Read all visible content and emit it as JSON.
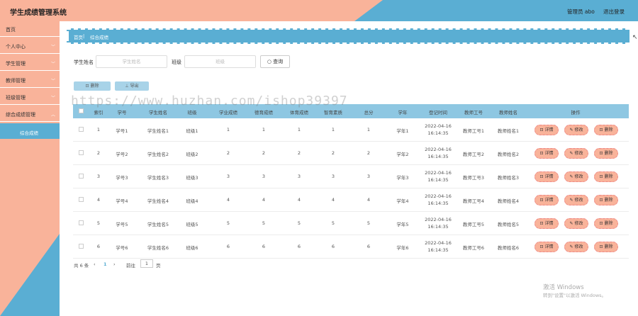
{
  "header": {
    "title": "学生成绩管理系统",
    "user": "管理员 abo",
    "logout": "退出登录"
  },
  "sidebar": {
    "items": [
      {
        "label": "首页",
        "chevron": ""
      },
      {
        "label": "个人中心",
        "chevron": "﹀"
      },
      {
        "label": "学生管理",
        "chevron": "﹀"
      },
      {
        "label": "教师管理",
        "chevron": "﹀"
      },
      {
        "label": "班级管理",
        "chevron": "﹀"
      },
      {
        "label": "综合成绩管理",
        "chevron": "︿"
      }
    ],
    "sub_item": "综合成绩"
  },
  "breadcrumb": {
    "home": "首页",
    "separator": "|",
    "current": "综合成绩"
  },
  "search": {
    "name_label": "学生姓名",
    "name_placeholder": "学生姓名",
    "class_label": "班级",
    "class_placeholder": "班级",
    "button": "查询"
  },
  "toolbar": {
    "delete": "删除",
    "export": "导出"
  },
  "watermark": "https://www.huzhan.com/ishop39397",
  "table": {
    "headers": [
      "索引",
      "学号",
      "学生姓名",
      "班级",
      "学业成绩",
      "德育成绩",
      "体育成绩",
      "智育素质",
      "总分",
      "学年",
      "登记时间",
      "教师工号",
      "教师姓名",
      "操作"
    ],
    "rows": [
      [
        "1",
        "学号1",
        "学生姓名1",
        "班级1",
        "1",
        "1",
        "1",
        "1",
        "1",
        "学年1",
        "2022-04-16",
        "16:14:35",
        "教师工号1",
        "教师姓名1"
      ],
      [
        "2",
        "学号2",
        "学生姓名2",
        "班级2",
        "2",
        "2",
        "2",
        "2",
        "2",
        "学年2",
        "2022-04-16",
        "16:14:35",
        "教师工号2",
        "教师姓名2"
      ],
      [
        "3",
        "学号3",
        "学生姓名3",
        "班级3",
        "3",
        "3",
        "3",
        "3",
        "3",
        "学年3",
        "2022-04-16",
        "16:14:35",
        "教师工号3",
        "教师姓名3"
      ],
      [
        "4",
        "学号4",
        "学生姓名4",
        "班级4",
        "4",
        "4",
        "4",
        "4",
        "4",
        "学年4",
        "2022-04-16",
        "16:14:35",
        "教师工号4",
        "教师姓名4"
      ],
      [
        "5",
        "学号5",
        "学生姓名5",
        "班级5",
        "5",
        "5",
        "5",
        "5",
        "5",
        "学年5",
        "2022-04-16",
        "16:14:35",
        "教师工号5",
        "教师姓名5"
      ],
      [
        "6",
        "学号6",
        "学生姓名6",
        "班级6",
        "6",
        "6",
        "6",
        "6",
        "6",
        "学年6",
        "2022-04-16",
        "16:14:35",
        "教师工号6",
        "教师姓名6"
      ]
    ],
    "ops": {
      "detail": "详情",
      "edit": "修改",
      "delete": "删除"
    }
  },
  "pager": {
    "total": "共 6 条",
    "prev": "‹",
    "page": "1",
    "next": "›",
    "goto_label": "前往",
    "goto_value": "1",
    "unit": "页"
  },
  "os_watermark": {
    "line1": "激活 Windows",
    "line2": "转到\"设置\"以激活 Windows。"
  },
  "colors": {
    "accent_blue": "#5aaed3",
    "accent_peach": "#f9b39a",
    "table_header": "#8ec7e2"
  }
}
